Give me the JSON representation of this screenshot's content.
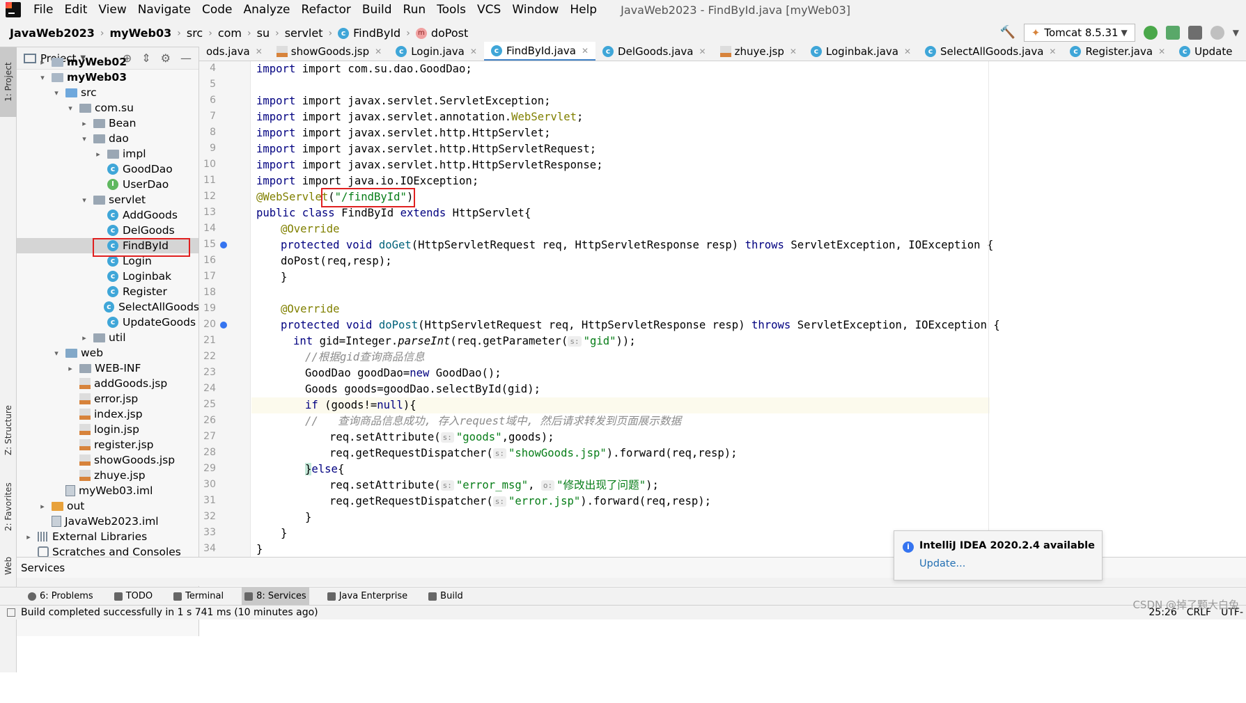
{
  "menubar": {
    "items": [
      "File",
      "Edit",
      "View",
      "Navigate",
      "Code",
      "Analyze",
      "Refactor",
      "Build",
      "Run",
      "Tools",
      "VCS",
      "Window",
      "Help"
    ],
    "window_title": "JavaWeb2023 - FindById.java [myWeb03]"
  },
  "breadcrumb": [
    "JavaWeb2023",
    "myWeb03",
    "src",
    "com",
    "su",
    "servlet",
    "FindById",
    "doPost"
  ],
  "run_config": "Tomcat 8.5.31",
  "left_strip": [
    "1: Project",
    "Z: Structure",
    "2: Favorites",
    "Web"
  ],
  "project": {
    "title": "Project",
    "tree": [
      {
        "label": "myWeb02",
        "depth": 1,
        "arrow": "›",
        "icon": "module"
      },
      {
        "label": "myWeb03",
        "depth": 1,
        "arrow": "⌄",
        "icon": "module"
      },
      {
        "label": "src",
        "depth": 2,
        "arrow": "⌄",
        "icon": "src"
      },
      {
        "label": "com.su",
        "depth": 3,
        "arrow": "⌄",
        "icon": "pkg"
      },
      {
        "label": "Bean",
        "depth": 4,
        "arrow": "›",
        "icon": "pkg"
      },
      {
        "label": "dao",
        "depth": 4,
        "arrow": "⌄",
        "icon": "pkg"
      },
      {
        "label": "impl",
        "depth": 5,
        "arrow": "›",
        "icon": "pkg"
      },
      {
        "label": "GoodDao",
        "depth": 5,
        "arrow": "",
        "icon": "class"
      },
      {
        "label": "UserDao",
        "depth": 5,
        "arrow": "",
        "icon": "interface"
      },
      {
        "label": "servlet",
        "depth": 4,
        "arrow": "⌄",
        "icon": "pkg"
      },
      {
        "label": "AddGoods",
        "depth": 5,
        "arrow": "",
        "icon": "class"
      },
      {
        "label": "DelGoods",
        "depth": 5,
        "arrow": "",
        "icon": "class"
      },
      {
        "label": "FindById",
        "depth": 5,
        "arrow": "",
        "icon": "class",
        "selected": true
      },
      {
        "label": "Login",
        "depth": 5,
        "arrow": "",
        "icon": "class"
      },
      {
        "label": "Loginbak",
        "depth": 5,
        "arrow": "",
        "icon": "class"
      },
      {
        "label": "Register",
        "depth": 5,
        "arrow": "",
        "icon": "class"
      },
      {
        "label": "SelectAllGoods",
        "depth": 5,
        "arrow": "",
        "icon": "class"
      },
      {
        "label": "UpdateGoods",
        "depth": 5,
        "arrow": "",
        "icon": "class"
      },
      {
        "label": "util",
        "depth": 4,
        "arrow": "›",
        "icon": "pkg"
      },
      {
        "label": "web",
        "depth": 2,
        "arrow": "⌄",
        "icon": "web"
      },
      {
        "label": "WEB-INF",
        "depth": 3,
        "arrow": "›",
        "icon": "pkg"
      },
      {
        "label": "addGoods.jsp",
        "depth": 3,
        "arrow": "",
        "icon": "jsp"
      },
      {
        "label": "error.jsp",
        "depth": 3,
        "arrow": "",
        "icon": "jsp"
      },
      {
        "label": "index.jsp",
        "depth": 3,
        "arrow": "",
        "icon": "jsp"
      },
      {
        "label": "login.jsp",
        "depth": 3,
        "arrow": "",
        "icon": "jsp"
      },
      {
        "label": "register.jsp",
        "depth": 3,
        "arrow": "",
        "icon": "jsp"
      },
      {
        "label": "showGoods.jsp",
        "depth": 3,
        "arrow": "",
        "icon": "jsp"
      },
      {
        "label": "zhuye.jsp",
        "depth": 3,
        "arrow": "",
        "icon": "jsp"
      },
      {
        "label": "myWeb03.iml",
        "depth": 2,
        "arrow": "",
        "icon": "iml"
      },
      {
        "label": "out",
        "depth": 1,
        "arrow": "›",
        "icon": "orange"
      },
      {
        "label": "JavaWeb2023.iml",
        "depth": 1,
        "arrow": "",
        "icon": "iml"
      },
      {
        "label": "External Libraries",
        "depth": 0,
        "arrow": "›",
        "icon": "lib"
      },
      {
        "label": "Scratches and Consoles",
        "depth": 0,
        "arrow": "",
        "icon": "scratch"
      }
    ]
  },
  "tabs": [
    {
      "label": "ods.java",
      "icon": "none"
    },
    {
      "label": "showGoods.jsp",
      "icon": "jsp"
    },
    {
      "label": "Login.java",
      "icon": "class"
    },
    {
      "label": "FindById.java",
      "icon": "class",
      "active": true
    },
    {
      "label": "DelGoods.java",
      "icon": "class"
    },
    {
      "label": "zhuye.jsp",
      "icon": "jsp"
    },
    {
      "label": "Loginbak.java",
      "icon": "class"
    },
    {
      "label": "SelectAllGoods.java",
      "icon": "class"
    },
    {
      "label": "Register.java",
      "icon": "class"
    },
    {
      "label": "Update",
      "icon": "class"
    }
  ],
  "editor": {
    "line_numbers": [
      "4",
      "5",
      "6",
      "7",
      "8",
      "9",
      "10",
      "11",
      "12",
      "13",
      "14",
      "15",
      "16",
      "17",
      "18",
      "19",
      "20",
      "21",
      "22",
      "23",
      "24",
      "25",
      "26",
      "27",
      "28",
      "29",
      "30",
      "31",
      "32",
      "33",
      "34"
    ],
    "lines": {
      "l4": "import com.su.dao.GoodDao;",
      "l6": "import javax.servlet.ServletException;",
      "l7a": "import javax.servlet.annotation.",
      "l7b": "WebServlet",
      "l7c": ";",
      "l8": "import javax.servlet.http.HttpServlet;",
      "l9": "import javax.servlet.http.HttpServletRequest;",
      "l10": "import javax.servlet.http.HttpServletResponse;",
      "l11": "import java.io.IOException;",
      "l12_ann": "@WebServlet",
      "l12_str": "\"/findById\"",
      "l13a": "public class ",
      "l13b": "FindById ",
      "l13c": "extends ",
      "l13d": "HttpServlet{",
      "l14": "@Override",
      "l15a": "protected void ",
      "l15b": "doGet",
      "l15c": "(HttpServletRequest req, HttpServletResponse resp) ",
      "l15d": "throws ",
      "l15e": "ServletException, IOException {",
      "l16": "doPost(req,resp);",
      "l17": "}",
      "l19": "@Override",
      "l20a": "protected void ",
      "l20b": "doPost",
      "l20c": "(HttpServletRequest req, HttpServletResponse resp) ",
      "l20d": "throws ",
      "l20e": "ServletException, IOException {",
      "l21a": "int ",
      "l21b": "gid=Integer.",
      "l21c": "parseInt",
      "l21d": "(req.getParameter(",
      "l21hint": "s:",
      "l21e": "\"gid\"",
      "l21f": "));",
      "l22": "//根据gid查询商品信息",
      "l23a": "GoodDao goodDao=",
      "l23b": "new ",
      "l23c": "GoodDao();",
      "l24": "Goods goods=goodDao.selectById(gid);",
      "l25a": "if ",
      "l25b": "(goods!=",
      "l25c": "null",
      "l25d": "){",
      "l26": "//   查询商品信息成功, 存入request域中, 然后请求转发到页面展示数据",
      "l27a": "req.setAttribute(",
      "l27hint": "s:",
      "l27b": "\"goods\"",
      "l27c": ",goods);",
      "l28a": "req.getRequestDispatcher(",
      "l28hint": "s:",
      "l28b": "\"showGoods.jsp\"",
      "l28c": ").forward(req,resp);",
      "l29a": "}",
      "l29b": "else",
      "l29c": "{",
      "l30a": "req.setAttribute(",
      "l30hint1": "s:",
      "l30b": "\"error_msg\"",
      "l30c": ", ",
      "l30hint2": "o:",
      "l30d": "\"修改出现了问题\"",
      "l30e": ");",
      "l31a": "req.getRequestDispatcher(",
      "l31hint": "s:",
      "l31b": "\"error.jsp\"",
      "l31c": ").forward(req,resp);",
      "l32": "}",
      "l33": "}",
      "l34": "}"
    }
  },
  "services_label": "Services",
  "tool_tabs": [
    "6: Problems",
    "TODO",
    "Terminal",
    "8: Services",
    "Java Enterprise",
    "Build"
  ],
  "status": {
    "message": "Build completed successfully in 1 s 741 ms (10 minutes ago)",
    "position": "25:26",
    "line_sep": "CRLF",
    "encoding": "UTF-"
  },
  "notification": {
    "title": "IntelliJ IDEA 2020.2.4 available",
    "link": "Update..."
  },
  "watermark": "CSDN @掉了颗大白兔"
}
